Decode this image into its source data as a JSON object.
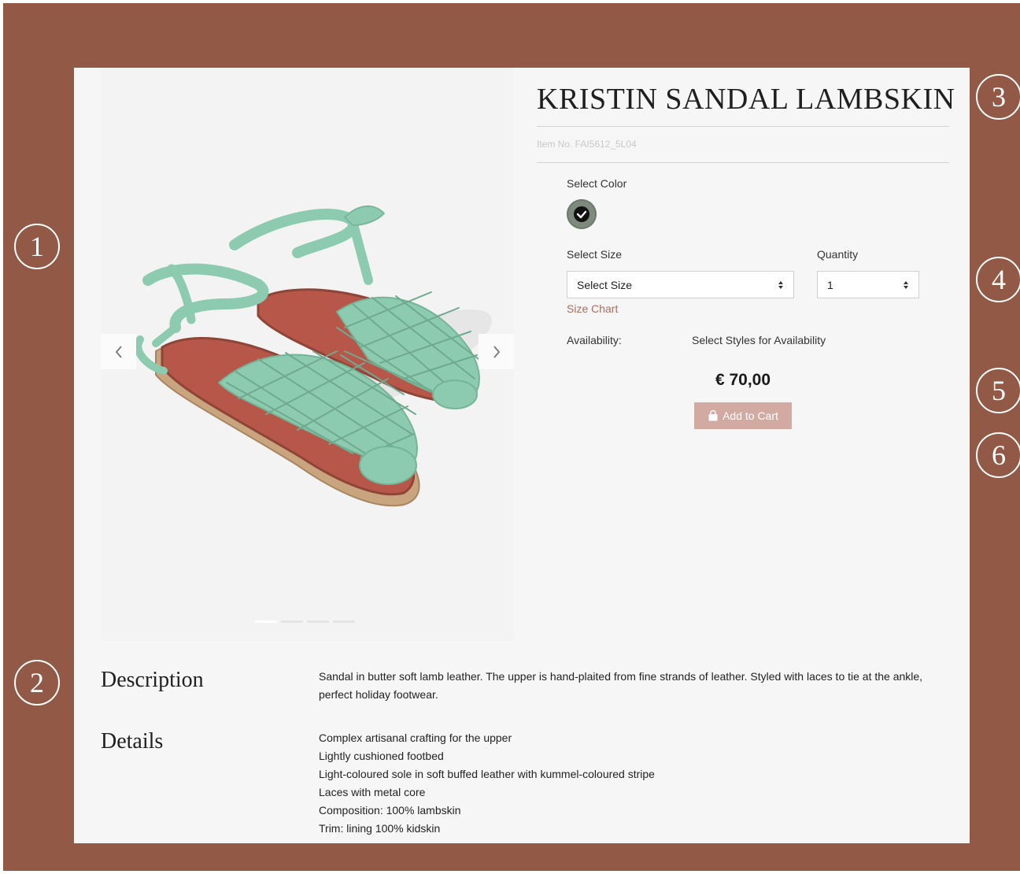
{
  "product": {
    "title": "KRISTIN SANDAL LAMBSKIN",
    "item_no": "Item No. FAI5612_5L04",
    "select_color_label": "Select Color",
    "select_size_label": "Select Size",
    "size_select_value": "Select Size",
    "quantity_label": "Quantity",
    "quantity_value": "1",
    "size_chart_link": "Size Chart",
    "availability_label": "Availability:",
    "availability_value": "Select Styles for Availability",
    "price": "€ 70,00",
    "add_to_cart": "Add to Cart"
  },
  "gallery": {
    "slide_count": 4,
    "active_slide": 1
  },
  "description": {
    "title": "Description",
    "text": "Sandal in butter soft lamb leather. The upper is hand-plaited from fine strands of leather. Styled with laces to tie at the ankle, perfect holiday footwear."
  },
  "details": {
    "title": "Details",
    "items": [
      "Complex artisanal crafting for the upper",
      "Lightly cushioned footbed",
      "Light-coloured sole in soft buffed leather with kummel-coloured stripe",
      "Laces with metal core",
      "Composition: 100% lambskin",
      "Trim: lining 100% kidskin"
    ]
  },
  "callouts": [
    "1",
    "2",
    "3",
    "4",
    "5",
    "6"
  ],
  "colors": {
    "frame": "#935947",
    "card": "#f6f6f6",
    "sandal": "#8ccbb0",
    "cart_button": "#d2aaa1",
    "size_chart_link": "#a86f5f",
    "swatch": "#7d8a7d"
  }
}
